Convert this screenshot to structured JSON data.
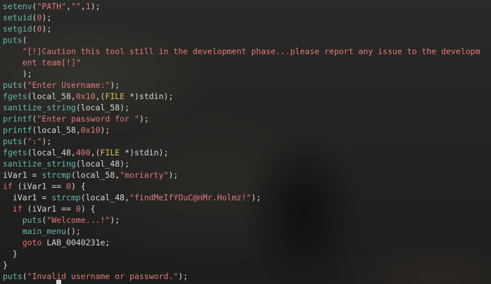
{
  "code_lines": [
    [
      "setenv",
      "(",
      "\"PATH\"",
      ",",
      "\"\"",
      ",",
      "1",
      ");"
    ],
    [
      "setuid",
      "(",
      "0",
      ");"
    ],
    [
      "setgid",
      "(",
      "0",
      ");"
    ],
    [
      "puts",
      "("
    ],
    [
      "    ",
      "\"[!]Caution this tool still in the development phase...please report any issue to the developm"
    ],
    [
      "    ",
      "ent team[!]\""
    ],
    [
      "    ",
      ");"
    ],
    [
      "puts",
      "(",
      "\"Enter Username:\"",
      ");"
    ],
    [
      "fgets",
      "(local_58,",
      "0x10",
      ",(",
      "FILE",
      " *)stdin);"
    ],
    [
      "sanitize_string",
      "(local_58);"
    ],
    [
      "printf",
      "(",
      "\"Enter password for \"",
      ");"
    ],
    [
      "printf",
      "(local_58,",
      "0x10",
      ");"
    ],
    [
      "puts",
      "(",
      "\":\"",
      ");"
    ],
    [
      "fgets",
      "(local_48,",
      "400",
      ",(",
      "FILE",
      " *)stdin);"
    ],
    [
      "sanitize_string",
      "(local_48);"
    ],
    [
      "iVar1 = ",
      "strcmp",
      "(local_58,",
      "\"moriarty\"",
      ");"
    ],
    [
      "if",
      " (iVar1 == ",
      "0",
      ") {"
    ],
    [
      "  iVar1 = ",
      "strcmp",
      "(local_48,",
      "\"findMeIfYOuC@nMr.Holmz!\"",
      ");"
    ],
    [
      "  ",
      "if",
      " (iVar1 == ",
      "0",
      ") {"
    ],
    [
      "    ",
      "puts",
      "(",
      "\"Welcome...!\"",
      ");"
    ],
    [
      "    ",
      "main_menu",
      "();"
    ],
    [
      "    ",
      "goto",
      " LAB_0040231e;"
    ],
    [
      "  }"
    ],
    [
      "}"
    ],
    [
      "puts",
      "(",
      "\"Invalid username or password.\"",
      ");"
    ]
  ],
  "code_classes": [
    [
      "fn",
      "plain",
      "str",
      "plain",
      "str",
      "plain",
      "num",
      "plain"
    ],
    [
      "fn",
      "plain",
      "num",
      "plain"
    ],
    [
      "fn",
      "plain",
      "num",
      "plain"
    ],
    [
      "fn",
      "plain"
    ],
    [
      "plain",
      "str"
    ],
    [
      "plain",
      "str"
    ],
    [
      "plain",
      "plain"
    ],
    [
      "fn",
      "plain",
      "str",
      "plain"
    ],
    [
      "fn",
      "plain",
      "num",
      "plain",
      "ty",
      "plain"
    ],
    [
      "fn",
      "plain"
    ],
    [
      "fn",
      "plain",
      "str",
      "plain"
    ],
    [
      "fn",
      "plain",
      "num",
      "plain"
    ],
    [
      "fn",
      "plain",
      "str",
      "plain"
    ],
    [
      "fn",
      "plain",
      "num",
      "plain",
      "ty",
      "plain"
    ],
    [
      "fn",
      "plain"
    ],
    [
      "plain",
      "fn",
      "plain",
      "str",
      "plain"
    ],
    [
      "kw",
      "plain",
      "num",
      "plain"
    ],
    [
      "plain",
      "fn",
      "plain",
      "str",
      "plain"
    ],
    [
      "plain",
      "kw",
      "plain",
      "num",
      "plain"
    ],
    [
      "plain",
      "fn",
      "plain",
      "str",
      "plain"
    ],
    [
      "plain",
      "fn",
      "plain"
    ],
    [
      "plain",
      "kw",
      "plain"
    ],
    [
      "plain"
    ],
    [
      "plain"
    ],
    [
      "fn",
      "plain",
      "str",
      "plain"
    ]
  ],
  "colors": {
    "function": "#67b7b1",
    "string": "#e07a7a",
    "number": "#e07a7a",
    "type": "#d6c25f",
    "keyword": "#e36f6f",
    "text": "#d7d7d7",
    "background": "#1e1f1f"
  }
}
